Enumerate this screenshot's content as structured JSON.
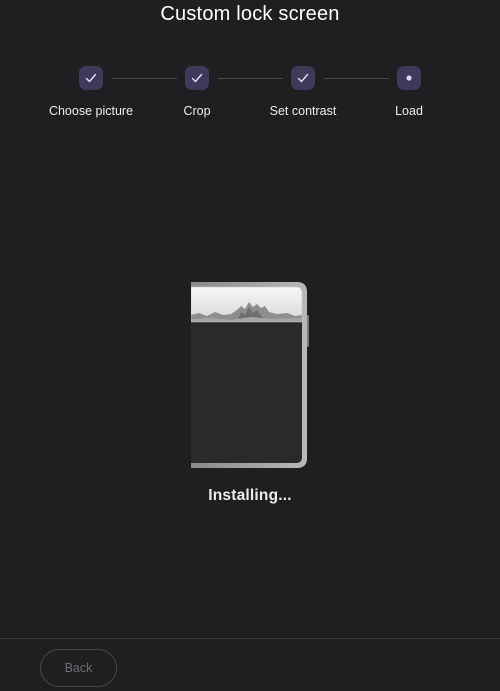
{
  "header": {
    "title": "Custom lock screen"
  },
  "stepper": {
    "steps": [
      {
        "label": "Choose picture",
        "state": "completed",
        "icon": "checkmark-icon"
      },
      {
        "label": "Crop",
        "state": "completed",
        "icon": "checkmark-icon"
      },
      {
        "label": "Set contrast",
        "state": "completed",
        "icon": "checkmark-icon"
      },
      {
        "label": "Load",
        "state": "current",
        "icon": "dot-icon"
      }
    ]
  },
  "main": {
    "status_text": "Installing..."
  },
  "footer": {
    "back_label": "Back"
  },
  "colors": {
    "background": "#1f1f21",
    "step_badge": "#3d3a5a",
    "step_icon": "#dcd8ff",
    "text_primary": "#ffffff",
    "button_disabled_text": "#6d6d72"
  }
}
